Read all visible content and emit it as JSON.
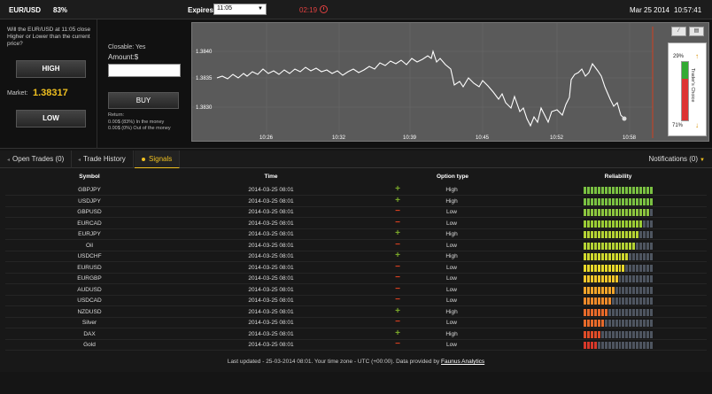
{
  "topbar": {
    "asset": "EUR/USD",
    "payout": "83%",
    "expires_label": "Expires:",
    "expires_value": "11:05",
    "countdown": "02:19",
    "date": "Mar 25 2014",
    "time": "10:57:41"
  },
  "trade": {
    "question": "Will the EUR/USD at 11:05 close Higher or Lower than the current price?",
    "high_label": "HIGH",
    "low_label": "LOW",
    "market_label": "Market:",
    "market_value": "1.38317",
    "closable": "Closable: Yes",
    "amount_label": "Amount:$",
    "amount_value": "",
    "buy_label": "BUY",
    "return_label": "Return:",
    "return_money": "0.00$ (83%) In the money",
    "return_out": "0.00$ (0%) Out of the money"
  },
  "chart": {
    "y_ticks": [
      "1.3840",
      "1.3835",
      "1.3830"
    ],
    "x_ticks": [
      "10:26",
      "10:32",
      "10:39",
      "10:45",
      "10:52",
      "10:58"
    ],
    "traders_choice_label": "Trader's Choice",
    "traders_choice_high": "29%",
    "traders_choice_low": "71%",
    "traders_choice_high_fraction": 0.29,
    "btn_line_icon": "line-chart-icon",
    "btn_candle_icon": "candle-chart-icon",
    "colors": {
      "line": "#ffffff",
      "bg": "#5a5a5a",
      "expiry_line": "#d04020",
      "high": "#33aa33",
      "low": "#dd3333"
    }
  },
  "tabs": {
    "open_trades": "Open Trades (0)",
    "trade_history": "Trade History",
    "signals": "Signals",
    "notifications": "Notifications (0)"
  },
  "signals": {
    "headers": {
      "symbol": "Symbol",
      "time": "Time",
      "option_type": "Option type",
      "reliability": "Reliability"
    },
    "rows": [
      {
        "symbol": "GBPJPY",
        "time": "2014-03-25 08:01",
        "sign": "+",
        "type": "High",
        "reliability": 1.0
      },
      {
        "symbol": "USDJPY",
        "time": "2014-03-25 08:01",
        "sign": "+",
        "type": "High",
        "reliability": 1.0
      },
      {
        "symbol": "GBPUSD",
        "time": "2014-03-25 08:01",
        "sign": "−",
        "type": "Low",
        "reliability": 0.96
      },
      {
        "symbol": "EURCAD",
        "time": "2014-03-25 08:01",
        "sign": "−",
        "type": "Low",
        "reliability": 0.85
      },
      {
        "symbol": "EURJPY",
        "time": "2014-03-25 08:01",
        "sign": "+",
        "type": "High",
        "reliability": 0.8
      },
      {
        "symbol": "Oil",
        "time": "2014-03-25 08:01",
        "sign": "−",
        "type": "Low",
        "reliability": 0.74
      },
      {
        "symbol": "USDCHF",
        "time": "2014-03-25 08:01",
        "sign": "+",
        "type": "High",
        "reliability": 0.67
      },
      {
        "symbol": "EURUSD",
        "time": "2014-03-25 08:01",
        "sign": "−",
        "type": "Low",
        "reliability": 0.6
      },
      {
        "symbol": "EURGBP",
        "time": "2014-03-25 08:01",
        "sign": "−",
        "type": "Low",
        "reliability": 0.52
      },
      {
        "symbol": "AUDUSD",
        "time": "2014-03-25 08:01",
        "sign": "−",
        "type": "Low",
        "reliability": 0.46
      },
      {
        "symbol": "USDCAD",
        "time": "2014-03-25 08:01",
        "sign": "−",
        "type": "Low",
        "reliability": 0.4
      },
      {
        "symbol": "NZDUSD",
        "time": "2014-03-25 08:01",
        "sign": "+",
        "type": "High",
        "reliability": 0.35
      },
      {
        "symbol": "Silver",
        "time": "2014-03-25 08:01",
        "sign": "−",
        "type": "Low",
        "reliability": 0.3
      },
      {
        "symbol": "DAX",
        "time": "2014-03-25 08:01",
        "sign": "+",
        "type": "High",
        "reliability": 0.25
      },
      {
        "symbol": "Gold",
        "time": "2014-03-25 08:01",
        "sign": "−",
        "type": "Low",
        "reliability": 0.2
      }
    ]
  },
  "footer": {
    "text": "Last updated - 25-03-2014 08:01. Your time zone - UTC (+00:00). Data provided by ",
    "link": "Faunus Analytics"
  }
}
